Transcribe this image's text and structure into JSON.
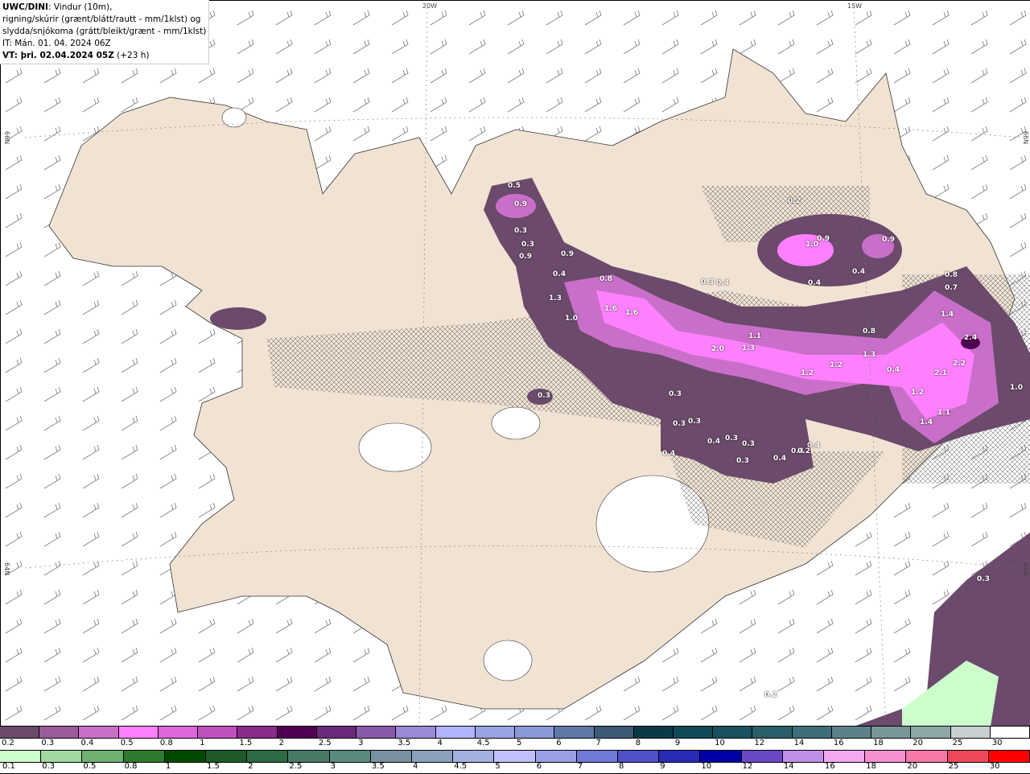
{
  "header": {
    "model": "UWC/DINI",
    "line1_rest": ": Vindur (10m),",
    "line2": "rigning/skúrir (grænt/blátt/rautt - mm/1klst) og",
    "line3": "slydda/snjókoma (grátt/bleikt/grænt - mm/1klst)",
    "issue_time": "IT: Mán. 01. 04. 2024 06Z",
    "valid_time": "VT: þri. 02.04.2024 05Z",
    "lead": " (+23 h)"
  },
  "grid_labels": {
    "lon_20w": "20W",
    "lon_15w": "15W",
    "lat_66n": "66N",
    "lat_64n": "64N"
  },
  "precip_labels": [
    "0.5",
    "0.9",
    "0.3",
    "0.3",
    "0.9",
    "0.9",
    "0.4",
    "0.8",
    "1.3",
    "1.6",
    "1.6",
    "1.0",
    "0.3",
    "0.4",
    "1.1",
    "2.0",
    "1.3",
    "0.2",
    "1.0",
    "0.9",
    "0.9",
    "0.4",
    "0.4",
    "0.8",
    "0.7",
    "1.4",
    "2.4",
    "0.8",
    "1.3",
    "1.2",
    "1.2",
    "0.4",
    "2.2",
    "2.1",
    "1.2",
    "1.1",
    "1.4",
    "1.0",
    "0.3",
    "0.3",
    "0.3",
    "0.3",
    "0.4",
    "0.3",
    "0.3",
    "0.3",
    "0.4",
    "0.4",
    "0.4",
    "0.4",
    "0.2",
    "0.3",
    "0.2"
  ],
  "legend": {
    "snow": {
      "labels": [
        "0.2",
        "0.3",
        "0.4",
        "0.5",
        "0.8",
        "1",
        "1.5",
        "2",
        "2.5",
        "3",
        "3.5",
        "4",
        "4.5",
        "5",
        "6",
        "7",
        "8",
        "9",
        "10",
        "12",
        "14",
        "16",
        "18",
        "20",
        "25",
        "30"
      ],
      "colors": [
        "#6b4a6b",
        "#9a5c9a",
        "#c96fc9",
        "#ff80ff",
        "#dd66dd",
        "#c050c0",
        "#8a2a8a",
        "#500050",
        "#6a2a7a",
        "#8a5aaa",
        "#9a88d8",
        "#b0b4ff",
        "#98a4e4",
        "#8a98d8",
        "#5e78a8",
        "#3a5a78",
        "#0a3a48",
        "#104a58",
        "#1a5060",
        "#2a5e68",
        "#3e6e78",
        "#5a8288",
        "#789698",
        "#8ea8a8",
        "#c8d0d4",
        "#ffffff"
      ]
    },
    "rain": {
      "labels": [
        "0.1",
        "0.3",
        "0.5",
        "0.8",
        "1",
        "1.5",
        "2",
        "2.5",
        "3",
        "3.5",
        "4",
        "4.5",
        "5",
        "6",
        "7",
        "8",
        "9",
        "10",
        "12",
        "14",
        "16",
        "18",
        "20",
        "25",
        "30"
      ],
      "colors": [
        "#ccffcc",
        "#a0d8a0",
        "#70b070",
        "#2e7a2e",
        "#004a00",
        "#1e5a2a",
        "#2e6a44",
        "#487a66",
        "#5a8a80",
        "#7890a0",
        "#8aa0bc",
        "#a4b0e0",
        "#c0c0ff",
        "#9aa0e8",
        "#7078d8",
        "#5050c8",
        "#2a2ab8",
        "#0000a8",
        "#6a48c8",
        "#c090e8",
        "#f4a8f0",
        "#f490d0",
        "#f878a8",
        "#f04858",
        "#ff0000"
      ]
    }
  }
}
